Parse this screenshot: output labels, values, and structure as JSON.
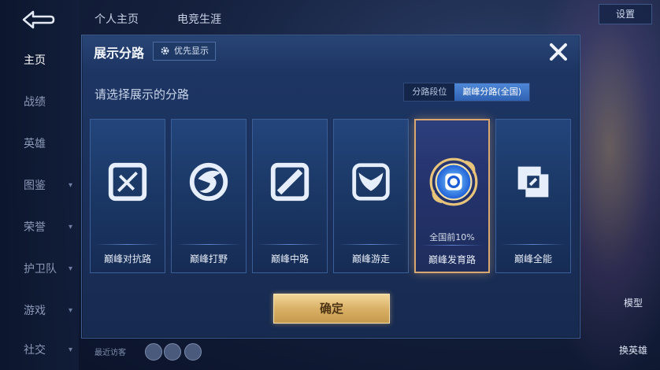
{
  "nav": {
    "items": [
      "主页",
      "战绩",
      "英雄",
      "图鉴",
      "荣誉",
      "护卫队",
      "游戏",
      "社交"
    ]
  },
  "top": {
    "tabs": [
      "个人主页",
      "电竞生涯"
    ],
    "settings_label": "设置"
  },
  "right": {
    "model_label": "模型",
    "swap_hero_label": "换英雄"
  },
  "bottom": {
    "recent_label": "最近访客"
  },
  "dialog": {
    "title": "展示分路",
    "priority_label": "优先显示",
    "subtitle": "请选择展示的分路",
    "segments": [
      "分路段位",
      "巅峰分路(全国)"
    ],
    "cards": [
      {
        "label": "巅峰对抗路",
        "rank": ""
      },
      {
        "label": "巅峰打野",
        "rank": ""
      },
      {
        "label": "巅峰中路",
        "rank": ""
      },
      {
        "label": "巅峰游走",
        "rank": ""
      },
      {
        "label": "巅峰发育路",
        "rank": "全国前10%"
      },
      {
        "label": "巅峰全能",
        "rank": ""
      }
    ],
    "confirm_label": "确定"
  },
  "colors": {
    "accent_blue": "#4f88d8",
    "gold": "#d9b066",
    "selected_border": "#d9a870"
  }
}
